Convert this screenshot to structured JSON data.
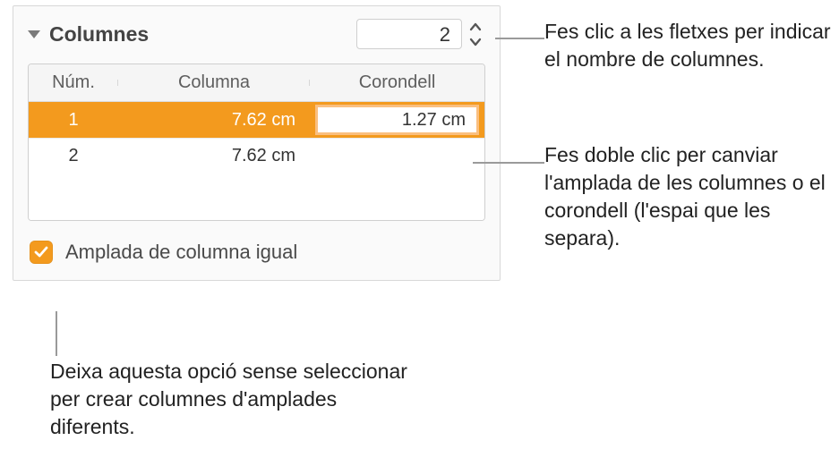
{
  "panel": {
    "title": "Columnes",
    "column_count": "2",
    "headers": {
      "num": "Núm.",
      "column": "Columna",
      "gutter": "Corondell"
    },
    "rows": [
      {
        "num": "1",
        "width": "7.62 cm",
        "gutter": "1.27 cm"
      },
      {
        "num": "2",
        "width": "7.62 cm",
        "gutter": ""
      }
    ],
    "equal_width_label": "Amplada de columna igual",
    "equal_width_checked": true
  },
  "callouts": {
    "stepper": "Fes clic a les fletxes per indicar el nombre de columnes.",
    "cell": "Fes doble clic per canviar l'amplada de les columnes o el corondell (l'espai que les separa).",
    "checkbox": "Deixa aquesta opció sense seleccionar per crear columnes d'amplades diferents."
  }
}
